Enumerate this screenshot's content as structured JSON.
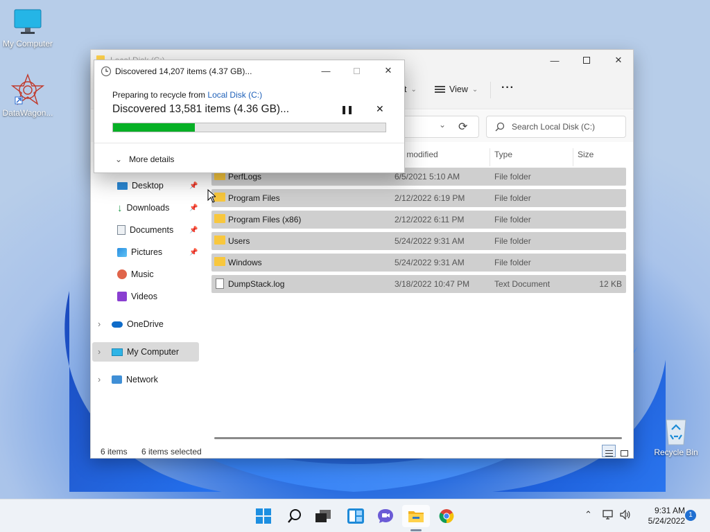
{
  "desktop": {
    "icons": [
      {
        "label": "My Computer",
        "icon": "monitor-icon"
      },
      {
        "label": "DataWagon...",
        "icon": "datawagon-icon"
      },
      {
        "label": "Recycle Bin",
        "icon": "recycle-bin-icon"
      }
    ]
  },
  "explorer": {
    "title": "Local Disk (C:)",
    "toolbar": {
      "sort_label": "t",
      "view_label": "View",
      "more_label": "···"
    },
    "search_placeholder": "Search Local Disk (C:)",
    "columns": {
      "date": "te modified",
      "type": "Type",
      "size": "Size"
    },
    "nav": [
      {
        "label": "Desktop",
        "icon": "desktop-icon",
        "pinned": true
      },
      {
        "label": "Downloads",
        "icon": "downloads-icon",
        "pinned": true
      },
      {
        "label": "Documents",
        "icon": "documents-icon",
        "pinned": true
      },
      {
        "label": "Pictures",
        "icon": "pictures-icon",
        "pinned": true
      },
      {
        "label": "Music",
        "icon": "music-icon",
        "pinned": false
      },
      {
        "label": "Videos",
        "icon": "videos-icon",
        "pinned": false
      },
      {
        "label": "OneDrive",
        "icon": "onedrive-icon",
        "pinned": false
      },
      {
        "label": "My Computer",
        "icon": "computer-icon",
        "pinned": false
      },
      {
        "label": "Network",
        "icon": "network-icon",
        "pinned": false
      }
    ],
    "files": [
      {
        "name": "PerfLogs",
        "date": "6/5/2021 5:10 AM",
        "type": "File folder",
        "size": "",
        "icon": "folder-icon"
      },
      {
        "name": "Program Files",
        "date": "2/12/2022 6:19 PM",
        "type": "File folder",
        "size": "",
        "icon": "folder-icon"
      },
      {
        "name": "Program Files (x86)",
        "date": "2/12/2022 6:11 PM",
        "type": "File folder",
        "size": "",
        "icon": "folder-icon"
      },
      {
        "name": "Users",
        "date": "5/24/2022 9:31 AM",
        "type": "File folder",
        "size": "",
        "icon": "folder-icon"
      },
      {
        "name": "Windows",
        "date": "5/24/2022 9:31 AM",
        "type": "File folder",
        "size": "",
        "icon": "folder-icon"
      },
      {
        "name": "DumpStack.log",
        "date": "3/18/2022 10:47 PM",
        "type": "Text Document",
        "size": "12 KB",
        "icon": "text-file-icon"
      }
    ],
    "status": {
      "count": "6 items",
      "selected": "6 items selected"
    }
  },
  "dialog": {
    "title": "Discovered 14,207 items (4.37 GB)...",
    "preparing_prefix": "Preparing to recycle from ",
    "preparing_link": "Local Disk (C:)",
    "status": "Discovered 13,581 items (4.36 GB)...",
    "progress": 0.3,
    "more_details": "More details",
    "accent": "#06b025"
  },
  "taskbar": {
    "time": "9:31 AM",
    "date": "5/24/2022",
    "notifications": "1"
  }
}
